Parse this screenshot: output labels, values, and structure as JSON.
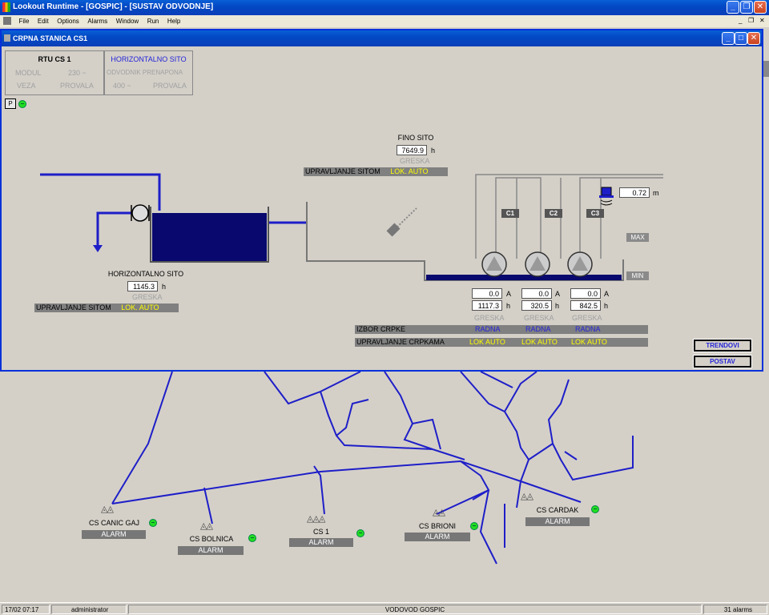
{
  "app": {
    "title": "Lookout Runtime - [GOSPIC] - [SUSTAV ODVODNJE]"
  },
  "menu": [
    "File",
    "Edit",
    "Options",
    "Alarms",
    "Window",
    "Run",
    "Help"
  ],
  "child": {
    "title": "CRPNA STANICA CS1",
    "rtu": {
      "left": {
        "title": "RTU CS 1",
        "r1a": "MODUL",
        "r1b": "230 ~",
        "r2a": "VEZA",
        "r2b": "PROVALA"
      },
      "right": {
        "title": "HORIZONTALNO SITO",
        "r1": "ODVODNIK PRENAPONA",
        "r2a": "400 ~",
        "r2b": "PROVALA"
      }
    },
    "p_button": "P",
    "fino_sito": {
      "title": "FINO SITO",
      "value": "7649.9",
      "unit": "h",
      "status": "GRESKA",
      "ctrl_label": "UPRAVLJANJE SITOM",
      "ctrl_value": "LOK. AUTO"
    },
    "horiz_sito": {
      "title": "HORIZONTALNO SITO",
      "value": "1145.3",
      "unit": "h",
      "status": "GRESKA",
      "ctrl_label": "UPRAVLJANJE SITOM",
      "ctrl_value": "LOK. AUTO"
    },
    "level": {
      "value": "0.72",
      "unit": "m",
      "max": "MAX",
      "min": "MIN"
    },
    "pumps": [
      {
        "name": "C1",
        "amps": "0.0",
        "hours": "1117.3",
        "status": "GRESKA",
        "select": "RADNA",
        "ctrl": "LOK AUTO"
      },
      {
        "name": "C2",
        "amps": "0.0",
        "hours": "320.5",
        "status": "GRESKA",
        "select": "RADNA",
        "ctrl": "LOK AUTO"
      },
      {
        "name": "C3",
        "amps": "0.0",
        "hours": "842.5",
        "status": "GRESKA",
        "select": "RADNA",
        "ctrl": "LOK AUTO"
      }
    ],
    "unit_a": "A",
    "unit_h": "h",
    "izbor_label": "IZBOR CRPKE",
    "upr_label": "UPRAVLJANJE CRPKAMA",
    "btn_trendovi": "TRENDOVI",
    "btn_postav": "POSTAV"
  },
  "stations": [
    {
      "name": "CS CANIC GAJ",
      "alarm": "ALARM"
    },
    {
      "name": "CS BOLNICA",
      "alarm": "ALARM"
    },
    {
      "name": "CS 1",
      "alarm": "ALARM"
    },
    {
      "name": "CS BRIONI",
      "alarm": "ALARM"
    },
    {
      "name": "CS CARDAK",
      "alarm": "ALARM"
    }
  ],
  "status": {
    "datetime": "17/02 07:17",
    "user": "administrator",
    "center": "VODOVOD GOSPIC",
    "alarms": "31 alarms"
  },
  "colors": {
    "pipe": "#1e1ec8",
    "tank": "#08086e",
    "led": "#22dd22"
  }
}
